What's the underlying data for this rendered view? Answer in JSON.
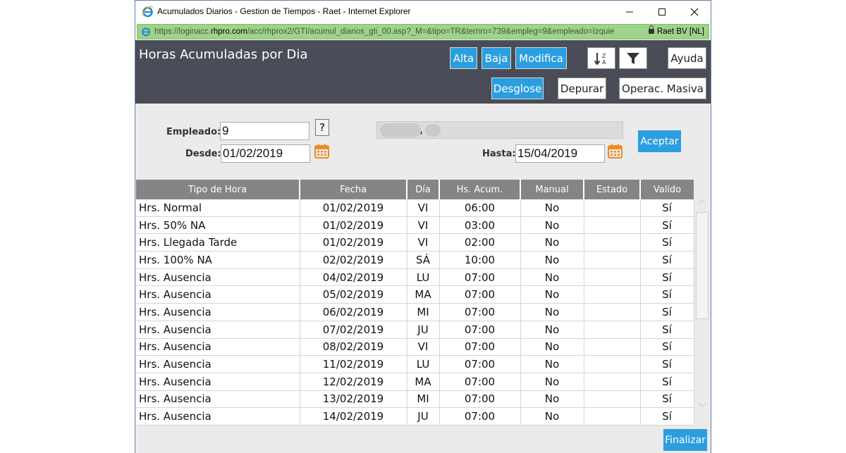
{
  "window": {
    "title": "Acumulados Diarios - Gestion de Tiempos - Raet - Internet Explorer",
    "url_prefix": "https://loginacc.",
    "url_host": "rhpro.com",
    "url_rest": "/acc/rhprox2/GTI/acumul_diarios_gti_00.asp?_M=&tipo=TR&ternro=739&empleg=9&empleado=Izquie",
    "site_identity": "Raet BV [NL]",
    "controls": {
      "minimize": "—",
      "maximize": "☐",
      "close": "✕"
    }
  },
  "header": {
    "title": "Horas Acumuladas por Dia",
    "buttons": {
      "alta": "Alta",
      "baja": "Baja",
      "modifica": "Modifica",
      "ayuda": "Ayuda",
      "desglose": "Desglose",
      "depurar": "Depurar",
      "operac_masiva": "Operac. Masiva"
    },
    "icons": {
      "sort": "sort-za-icon",
      "filter": "filter-icon"
    }
  },
  "form": {
    "empleado_label": "Empleado:",
    "empleado_value": "9",
    "help_button": "?",
    "employee_name_separator": ",",
    "desde_label": "Desde:",
    "desde_value": "01/02/2019",
    "hasta_label": "Hasta:",
    "hasta_value": "15/04/2019",
    "aceptar": "Aceptar"
  },
  "table": {
    "headers": [
      "Tipo de Hora",
      "Fecha",
      "Día",
      "Hs. Acum.",
      "Manual",
      "Estado",
      "Valido"
    ],
    "rows": [
      [
        "Hrs. Normal",
        "01/02/2019",
        "VI",
        "06:00",
        "No",
        "",
        "Sí"
      ],
      [
        "Hrs. 50% NA",
        "01/02/2019",
        "VI",
        "03:00",
        "No",
        "",
        "Sí"
      ],
      [
        "Hrs. Llegada Tarde",
        "01/02/2019",
        "VI",
        "02:00",
        "No",
        "",
        "Sí"
      ],
      [
        "Hrs. 100% NA",
        "02/02/2019",
        "SÁ",
        "10:00",
        "No",
        "",
        "Sí"
      ],
      [
        "Hrs. Ausencia",
        "04/02/2019",
        "LU",
        "07:00",
        "No",
        "",
        "Sí"
      ],
      [
        "Hrs. Ausencia",
        "05/02/2019",
        "MA",
        "07:00",
        "No",
        "",
        "Sí"
      ],
      [
        "Hrs. Ausencia",
        "06/02/2019",
        "MI",
        "07:00",
        "No",
        "",
        "Sí"
      ],
      [
        "Hrs. Ausencia",
        "07/02/2019",
        "JU",
        "07:00",
        "No",
        "",
        "Sí"
      ],
      [
        "Hrs. Ausencia",
        "08/02/2019",
        "VI",
        "07:00",
        "No",
        "",
        "Sí"
      ],
      [
        "Hrs. Ausencia",
        "11/02/2019",
        "LU",
        "07:00",
        "No",
        "",
        "Sí"
      ],
      [
        "Hrs. Ausencia",
        "12/02/2019",
        "MA",
        "07:00",
        "No",
        "",
        "Sí"
      ],
      [
        "Hrs. Ausencia",
        "13/02/2019",
        "MI",
        "07:00",
        "No",
        "",
        "Sí"
      ],
      [
        "Hrs. Ausencia",
        "14/02/2019",
        "JU",
        "07:00",
        "No",
        "",
        "Sí"
      ]
    ]
  },
  "footer": {
    "finalizar": "Finalizar"
  },
  "colors": {
    "accent": "#2b9ee0",
    "header_bg": "#4a4d57",
    "address_bg": "#9fd38a",
    "table_header": "#858585",
    "calendar": "#f08a24"
  }
}
